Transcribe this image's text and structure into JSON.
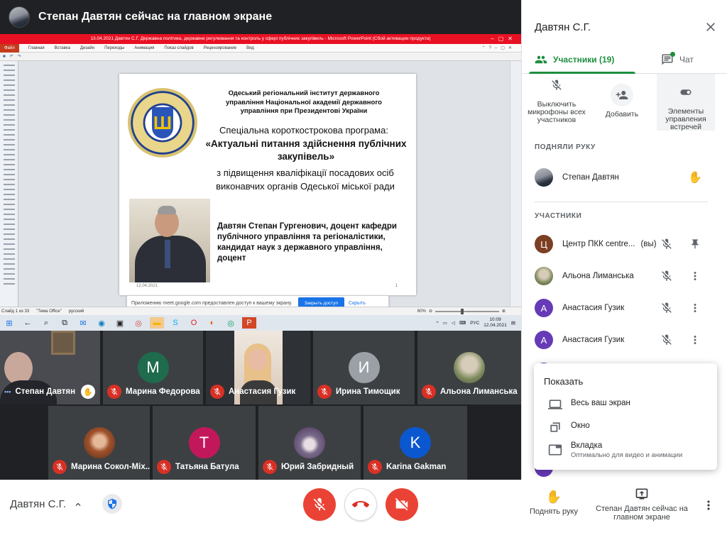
{
  "presentation": {
    "title": "Степан Давтян сейчас на главном экране"
  },
  "ppt": {
    "window_title": "13.04.2021 Давтян С.Г. Державна політика, державне регулювання та контроль у сфері публічних закупівель - Microsoft PowerPoint (Сбой активации продукта)",
    "menu": [
      "Файл",
      "Главная",
      "Вставка",
      "Дизайн",
      "Переходы",
      "Анимация",
      "Показ слайдов",
      "Рецензирование",
      "Вид"
    ],
    "status": {
      "slide": "Слайд 1 из 33",
      "theme": "\"Тема Office\"",
      "lang": "русский",
      "zoom": "60%"
    }
  },
  "slide": {
    "org": "Одеський регіональний інститут державного управління Національної академії державного управління при Президентові України",
    "program": "Спеціальна короткострокова програма:",
    "course": "«Актуальні питання здійснення публічних закупівель»",
    "qualification": "з підвищення кваліфікації посадових осіб виконавчих органів Одеської міської ради",
    "author": "Давтян Степан Гургенович, доцент кафедри публічного управління та регіоналістики, кандидат наук з державного управління, доцент",
    "date": "12.04.2021",
    "number": "1"
  },
  "share_notice": {
    "text": "Приложению meet.google.com предоставлен доступ к вашему экрану.",
    "stop": "Закрыть доступ",
    "hide": "Скрыть"
  },
  "taskbar": {
    "lang": "РУС",
    "time": "10:09",
    "date": "12.04.2021"
  },
  "tiles": [
    {
      "name": "Степан Давтян",
      "kind": "video",
      "hand": true
    },
    {
      "name": "Марина Федорова",
      "letter": "М",
      "color": "#1f6b4d"
    },
    {
      "name": "Анастасия Гузик",
      "kind": "video"
    },
    {
      "name": "Ирина Тимощик",
      "letter": "И",
      "color": "#9aa0a6"
    },
    {
      "name": "Альона Лиманська",
      "kind": "photo"
    },
    {
      "name": "Марина Сокол-Міх...",
      "kind": "photo"
    },
    {
      "name": "Татьяна Батула",
      "letter": "Т",
      "color": "#c2185b"
    },
    {
      "name": "Юрий Забридный",
      "kind": "photo"
    },
    {
      "name": "Karina Gakman",
      "letter": "K",
      "color": "#0b57d0"
    }
  ],
  "bottom": {
    "self_name": "Давтян С.Г.",
    "raise_hand": "Поднять руку",
    "presenting": "Степан Давтян сейчас на главном экране"
  },
  "panel": {
    "title": "Давтян С.Г.",
    "tab_people": "Участники (19)",
    "tab_chat": "Чат",
    "actions": {
      "mute_all": "Выключить микрофоны всех участников",
      "add": "Добавить",
      "controls": "Элементы управления встречей"
    },
    "raised_label": "ПОДНЯЛИ РУКУ",
    "raised": [
      {
        "name": "Степан Давтян"
      }
    ],
    "participants_label": "УЧАСТНИКИ",
    "participants": [
      {
        "name": "Центр ПКК centre...",
        "you": "(вы)",
        "letter": "Ц",
        "color": "#7b3f24"
      },
      {
        "name": "Альона Лиманська",
        "letter": "",
        "color": "#a6b39a"
      },
      {
        "name": "Анастасия Гузик",
        "letter": "А",
        "color": "#673ab7"
      },
      {
        "name": "Анастасия Гузик",
        "letter": "А",
        "color": "#673ab7"
      }
    ]
  },
  "present_menu": {
    "title": "Показать",
    "items": [
      {
        "label": "Весь ваш экран",
        "icon": "monitor-icon"
      },
      {
        "label": "Окно",
        "icon": "window-icon"
      },
      {
        "label": "Вкладка",
        "sub": "Оптимально для видео и анимации",
        "icon": "tab-icon"
      }
    ]
  }
}
